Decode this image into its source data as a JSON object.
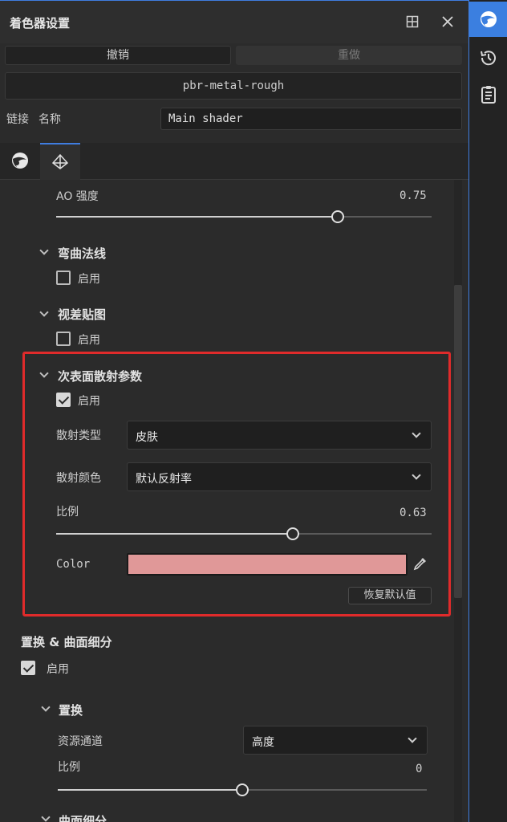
{
  "panel": {
    "title": "着色器设置",
    "undo_label": "撤销",
    "redo_label": "重做",
    "shader_model": "pbr-metal-rough",
    "link_label": "链接",
    "name_label": "名称",
    "name_value": "Main shader"
  },
  "tabs": [
    {
      "name": "material-tab",
      "icon": "sphere-icon",
      "active": false
    },
    {
      "name": "geometry-tab",
      "icon": "pyramid-icon",
      "active": true
    }
  ],
  "content": {
    "ao": {
      "label": "AO 强度",
      "value_text": "0.75",
      "value": 0.75
    },
    "bent_normals": {
      "title": "弯曲法线",
      "enable_label": "启用",
      "enabled": false
    },
    "parallax": {
      "title": "视差贴图",
      "enable_label": "启用",
      "enabled": false
    },
    "sss": {
      "title": "次表面散射参数",
      "enable_label": "启用",
      "enabled": true,
      "type_label": "散射类型",
      "type_value": "皮肤",
      "color_label": "散射颜色",
      "color_value": "默认反射率",
      "scale_label": "比例",
      "scale_text": "0.63",
      "scale": 0.63,
      "color_field_label": "Color",
      "color_hex": "#e09898",
      "reset_label": "恢复默认值"
    },
    "displacement": {
      "title": "置换 & 曲面细分",
      "enable_label": "启用",
      "enabled": true,
      "sub_title": "置换",
      "channel_label": "资源通道",
      "channel_value": "高度",
      "scale_label": "比例",
      "scale_text": "0",
      "scale": 0.5,
      "next_title": "曲面细分"
    }
  },
  "rail": [
    {
      "icon": "shader-ball-icon",
      "active": true
    },
    {
      "icon": "history-icon",
      "active": false
    },
    {
      "icon": "notes-icon",
      "active": false
    }
  ],
  "colors": {
    "accent": "#3b7fe0",
    "highlight": "#e02b2b"
  }
}
